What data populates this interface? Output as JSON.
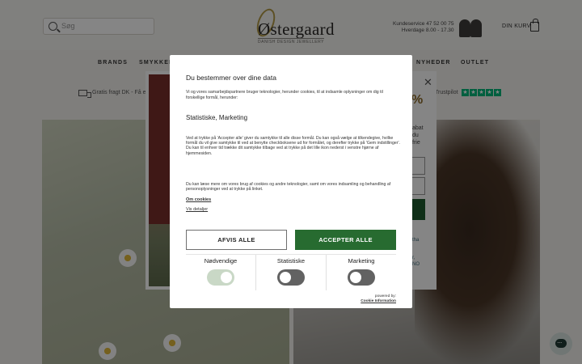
{
  "header": {
    "search_placeholder": "Søg",
    "logo_name": "Østergaard",
    "logo_sub": "DANISH DESIGN JEWELLERY",
    "service_line1": "Kundeservice 47 52 00 75",
    "service_line2": "Hverdage 8.00 - 17.30",
    "cart_label": "DIN KURV"
  },
  "nav": {
    "items": [
      "BRANDS",
      "SMYKKER",
      "NYHEDER",
      "OUTLET"
    ]
  },
  "usp": {
    "shipping_text": "Gratis fragt DK - Få ele",
    "trustpilot_text": "Trustpilot",
    "stars": [
      "★",
      "★",
      "★",
      "★",
      "★"
    ]
  },
  "newsletter": {
    "close": "✕",
    "percent": "%",
    "text1_a": "abat",
    "text1_b": "du",
    "text1_c": "frie",
    "text2_a": "tha",
    "text2_b": "r,",
    "text2_c": "NO"
  },
  "cookie": {
    "title": "Du bestemmer over dine data",
    "intro": "Vi og vores samarbejdspartnere bruger teknologier, herunder cookies, til at indsamle oplysninger om dig til forskellige formål, herunder:",
    "purposes": "Statistiske, Marketing",
    "body1": "Ved at trykke på 'Accepter alle' giver du samtykke til alle disse formål. Du kan også vælge at tilkendegive, hvilke formål du vil give samtykke til ved at benytte checkboksene ud for formålet, og derefter trykke på 'Gem indstillinger'.",
    "body2": "Du kan til enhver tid trække dit samtykke tilbage ved at trykke på det lille ikon nederst i venstre hjørne af hjemmesiden.",
    "more": "Du kan læse mere om vores brug af cookies og andre teknologier, samt om vores indsamling og behandling af personoplysninger ved at trykke på linket.",
    "about_link": "Om cookies",
    "details_link": "Vis detaljer",
    "reject_label": "AFVIS ALLE",
    "accept_label": "ACCEPTER ALLE",
    "toggles": [
      {
        "label": "Nødvendige",
        "state": "on"
      },
      {
        "label": "Statistiske",
        "state": "off"
      },
      {
        "label": "Marketing",
        "state": "off"
      }
    ],
    "powered_by": "powered by:",
    "powered_brand": "Cookie Information"
  },
  "colors": {
    "accept": "#276b30",
    "switch_off": "#626262",
    "switch_locked": "#c9d8c6"
  }
}
